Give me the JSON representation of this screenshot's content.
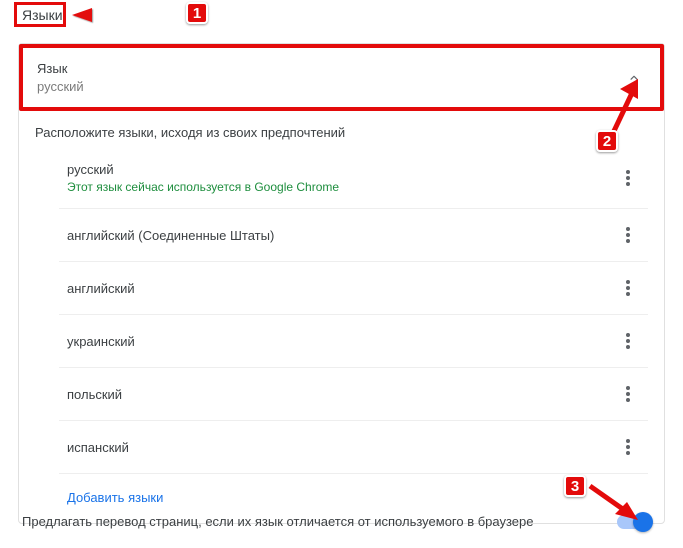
{
  "section_title": "Языки",
  "header": {
    "label": "Язык",
    "value": "русский"
  },
  "instruction": "Расположите языки, исходя из своих предпочтений",
  "languages": [
    {
      "name": "русский",
      "subtext": "Этот язык сейчас используется в Google Chrome"
    },
    {
      "name": "английский (Соединенные Штаты)"
    },
    {
      "name": "английский"
    },
    {
      "name": "украинский"
    },
    {
      "name": "польский"
    },
    {
      "name": "испанский"
    }
  ],
  "add_languages": "Добавить языки",
  "translate_toggle_label": "Предлагать перевод страниц, если их язык отличается от используемого в браузере",
  "badges": {
    "one": "1",
    "two": "2",
    "three": "3"
  }
}
